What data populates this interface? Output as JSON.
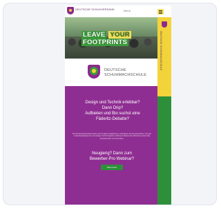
{
  "header": {
    "logo_text": "DEUTSCHE SCHUHVERSAND",
    "menu_label": "Menü"
  },
  "hero": {
    "line1_prefix": "LEAVE",
    "line1_highlight": "YOUR",
    "line2": "FOOTPRINTS"
  },
  "brand": {
    "name_line1": "DEUTSCHE",
    "name_line2": "SCHUHMACHSCHULE"
  },
  "rail": {
    "vertical_text": "DEUTSCHE SCHUHMACHSCHULE"
  },
  "content": {
    "questions": [
      "Design und Technik erlebbar?",
      "Dann Drip?",
      "Aufbieten und Bio suchst eine",
      "Fäderitz-Debatte?"
    ],
    "paragraph": "Die Schuhmacherschule bietet eine fundierte Ausbildung im Handwerk des Schuhmachers. Von der Leistenherstellung bis zum fertigen Schuh begleiten erfahrene Meister die Teilnehmer durch alle Arbeitsschritte und Techniken.",
    "cta_heading_line1": "Neugierig? Dann zum",
    "cta_heading_line2": "Bewerber-Pro Webinar?",
    "cta_button": "Mehr Infos"
  },
  "colors": {
    "purple": "#8f2e92",
    "green": "#2e8f3a",
    "yellow": "#f2d43a"
  }
}
